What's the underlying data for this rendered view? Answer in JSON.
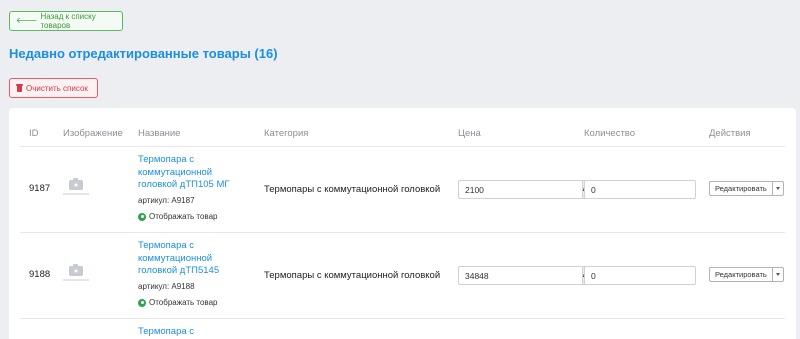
{
  "back_button": "Назад к списку товаров",
  "page_title": "Недавно отредактированные товары (16)",
  "clear_button": "Очистить список",
  "table": {
    "headers": {
      "id": "ID",
      "image": "Изображение",
      "name": "Название",
      "category": "Категория",
      "price": "Цена",
      "quantity": "Количество",
      "actions": "Действия"
    },
    "rows": [
      {
        "id": "9187",
        "name": "Термопара с коммутационной головкой дТП105 МГ",
        "sku": "артикул: А9187",
        "visible_label": "Отображать товар",
        "category": "Термопары с коммутационной головкой",
        "price": "2100",
        "currency": "₽",
        "quantity": "0",
        "edit_label": "Редактировать"
      },
      {
        "id": "9188",
        "name": "Термопара с коммутационной головкой дТП5145",
        "sku": "артикул: А9188",
        "visible_label": "Отображать товар",
        "category": "Термопары с коммутационной головкой",
        "price": "34848",
        "currency": "₽",
        "quantity": "0",
        "edit_label": "Редактировать"
      },
      {
        "name": "Термопара с"
      }
    ]
  },
  "colors": {
    "accent": "#1a8fe3",
    "success": "#5cb85c",
    "danger": "#e45b6a",
    "background": "#eceef1"
  }
}
